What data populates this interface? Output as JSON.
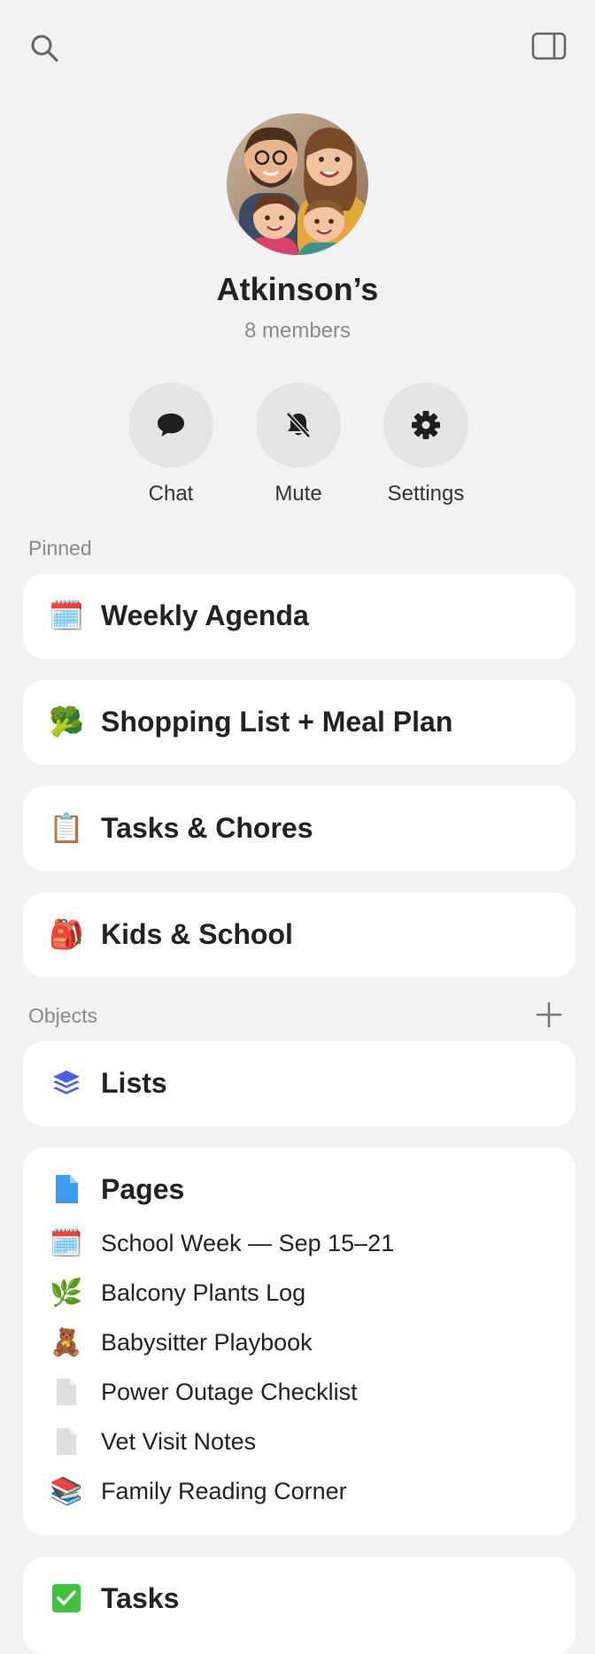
{
  "group": {
    "name": "Atkinson’s",
    "members": "8 members"
  },
  "actions": [
    {
      "label": "Chat",
      "icon": "chat-bubble-icon"
    },
    {
      "label": "Mute",
      "icon": "bell-slash-icon"
    },
    {
      "label": "Settings",
      "icon": "gear-icon"
    }
  ],
  "pinned": {
    "label": "Pinned",
    "items": [
      {
        "emoji": "🗓️",
        "label": "Weekly Agenda"
      },
      {
        "emoji": "🥦",
        "label": "Shopping List + Meal Plan"
      },
      {
        "emoji": "📋",
        "label": "Tasks & Chores"
      },
      {
        "emoji": "🎒",
        "label": "Kids & School"
      }
    ]
  },
  "objects": {
    "label": "Objects",
    "lists": {
      "label": "Lists",
      "icon": "stack-icon"
    },
    "pages": {
      "label": "Pages",
      "icon": "document-icon",
      "items": [
        {
          "emoji": "🗓️",
          "label": "School Week — Sep 15–21"
        },
        {
          "emoji": "🌿",
          "label": "Balcony Plants Log"
        },
        {
          "emoji": "🧸",
          "label": "Babysitter Playbook"
        },
        {
          "emoji": "",
          "label": "Power Outage Checklist"
        },
        {
          "emoji": "",
          "label": "Vet Visit Notes"
        },
        {
          "emoji": "📚",
          "label": "Family Reading Corner"
        }
      ]
    },
    "tasks": {
      "label": "Tasks",
      "icon": "checkbox-icon"
    }
  },
  "colors": {
    "background": "#f2f2f2",
    "card": "#ffffff",
    "accent_blue": "#3b82f6",
    "task_green": "#22c55e"
  }
}
